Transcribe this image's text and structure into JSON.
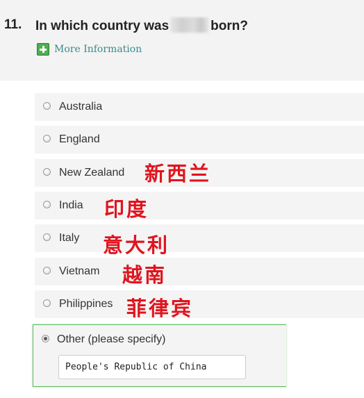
{
  "question": {
    "number": "11.",
    "text_before": "In which country was",
    "text_after": "born?"
  },
  "more_info": {
    "label": "More Information",
    "icon": "plus-icon",
    "icon_color": "#4caf50"
  },
  "options": [
    {
      "label": "Australia",
      "annotation": "",
      "selected": false
    },
    {
      "label": "England",
      "annotation": "",
      "selected": false
    },
    {
      "label": "New Zealand",
      "annotation": "新西兰",
      "selected": false
    },
    {
      "label": "India",
      "annotation": "印度",
      "selected": false
    },
    {
      "label": "Italy",
      "annotation": "意大利",
      "selected": false
    },
    {
      "label": "Vietnam",
      "annotation": "越南",
      "selected": false
    },
    {
      "label": "Philippines",
      "annotation": "菲律宾",
      "selected": false
    }
  ],
  "other": {
    "label": "Other (please specify)",
    "selected": true,
    "value": "People's Republic of China"
  },
  "colors": {
    "annotation": "#e0141e",
    "selected_border": "#5cb85c"
  }
}
